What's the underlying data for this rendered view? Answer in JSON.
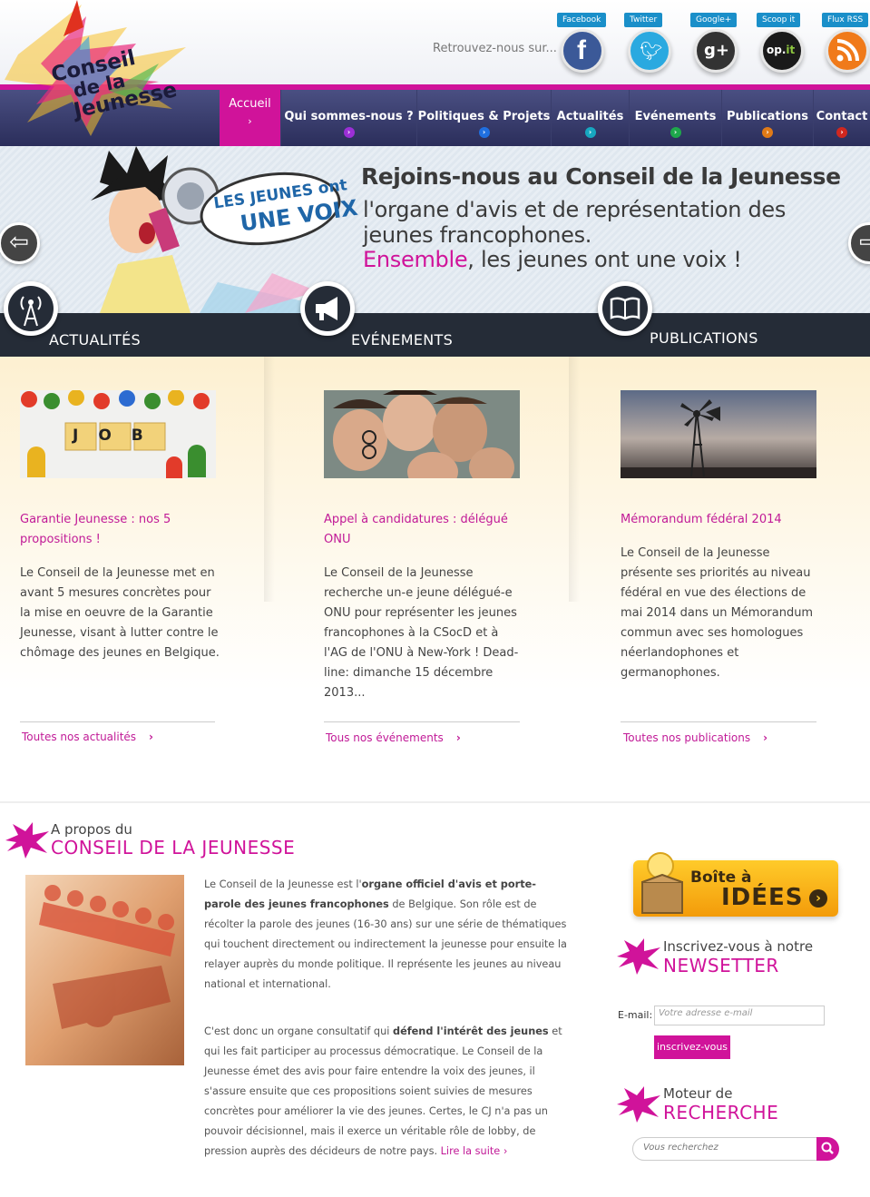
{
  "header": {
    "logo_lines": [
      "Conseil",
      "de la",
      "Jeunesse"
    ],
    "find_us": "Retrouvez-nous sur...",
    "social": [
      {
        "label": "Facebook",
        "icon": "facebook-icon",
        "color": "#3b5998"
      },
      {
        "label": "Twitter",
        "icon": "twitter-icon",
        "color": "#2aa9e0"
      },
      {
        "label": "Google+",
        "icon": "google-plus-icon",
        "color": "#333333"
      },
      {
        "label": "Scoop it",
        "icon": "scoop-it-icon",
        "color": "#1a1a1a"
      },
      {
        "label": "Flux RSS",
        "icon": "rss-icon",
        "color": "#f07a1a"
      }
    ]
  },
  "nav": {
    "items": [
      {
        "label": "Accueil",
        "active": true,
        "dot_color": "#d0139a"
      },
      {
        "label": "Qui sommes-nous ?",
        "dot_color": "#9b2fd6"
      },
      {
        "label": "Politiques & Projets",
        "dot_color": "#1f6fe0"
      },
      {
        "label": "Actualités",
        "dot_color": "#17a7c0"
      },
      {
        "label": "Evénements",
        "dot_color": "#1ea84b"
      },
      {
        "label": "Publications",
        "dot_color": "#e07a17"
      },
      {
        "label": "Contact",
        "dot_color": "#d0271f"
      }
    ]
  },
  "banner": {
    "bubble_lines": [
      "LES JEUNES ont",
      "UNE VOIX"
    ],
    "title": "Rejoins-nous au Conseil de la Jeunesse",
    "line1": "l'organe d'avis et de représentation des",
    "line2": "jeunes francophones.",
    "line3_highlight": "Ensemble",
    "line3_rest": ", les jeunes ont une voix !"
  },
  "tabs": [
    {
      "label": "ACTUALITÉS",
      "icon": "antenna-icon"
    },
    {
      "label": "EVÉNEMENTS",
      "icon": "megaphone-icon"
    },
    {
      "label": "PUBLICATIONS",
      "icon": "book-icon"
    }
  ],
  "news": [
    {
      "title": "Garantie Jeunesse : nos 5 propositions !",
      "body": "Le Conseil de la Jeunesse met en avant 5 mesures concrètes pour la mise en oeuvre de la Garantie Jeunesse, visant à lutter contre le chômage des jeunes en Belgique.",
      "link": "Toutes nos actualités",
      "image_text": "JOB"
    },
    {
      "title": "Appel à candidatures : délégué ONU",
      "body": "Le Conseil de la Jeunesse recherche un-e jeune délégué-e ONU pour représenter les jeunes francophones à la CSocD et à l'AG de l'ONU à New-York ! Dead-line: dimanche 15 décembre 2013...",
      "link": "Tous nos événements"
    },
    {
      "title": "Mémorandum fédéral 2014",
      "body": "Le Conseil de la Jeunesse présente ses priorités au niveau fédéral en vue des élections de mai 2014 dans un Mémorandum commun avec ses homologues néerlandophones et germanophones.",
      "link": "Toutes nos publications"
    }
  ],
  "about": {
    "title_small": "A propos du",
    "title_big": "CONSEIL DE LA JEUNESSE",
    "p1_a": "Le Conseil de la Jeunesse est l'",
    "p1_b": "organe officiel d'avis et porte-parole des jeunes francophones",
    "p1_c": " de Belgique. Son rôle est de récolter la parole des jeunes (16-30 ans) sur une série de thématiques qui touchent directement ou indirectement la jeunesse pour ensuite la relayer auprès du monde politique. Il représente les jeunes au niveau national et international.",
    "p2_a": "C'est donc un organe consultatif qui ",
    "p2_b": "défend l'intérêt des jeunes",
    "p2_c": " et qui les fait participer au processus démocratique. Le Conseil de la Jeunesse émet des avis pour faire entendre la voix des jeunes, il s'assure ensuite que ces propositions soient suivies de mesures concrètes pour améliorer la vie des jeunes. Certes, le CJ n'a pas un pouvoir décisionnel, mais il exerce un véritable rôle de lobby, de pression auprès des décideurs de notre pays.",
    "read_more": "Lire la suite"
  },
  "sidebar": {
    "idea_small": "Boîte à",
    "idea_big": "IDÉES",
    "newsletter_small": "Inscrivez-vous à notre",
    "newsletter_big": "NEWSETTER",
    "email_label": "E-mail:",
    "email_placeholder": "Votre adresse e-mail",
    "subscribe": "inscrivez-vous",
    "search_small": "Moteur de",
    "search_big": "RECHERCHE",
    "search_placeholder": "Vous recherchez"
  },
  "colors": {
    "brand_pink": "#d0139a",
    "nav_dark": "#2b2e5b",
    "tabs_dark": "#252c37"
  }
}
